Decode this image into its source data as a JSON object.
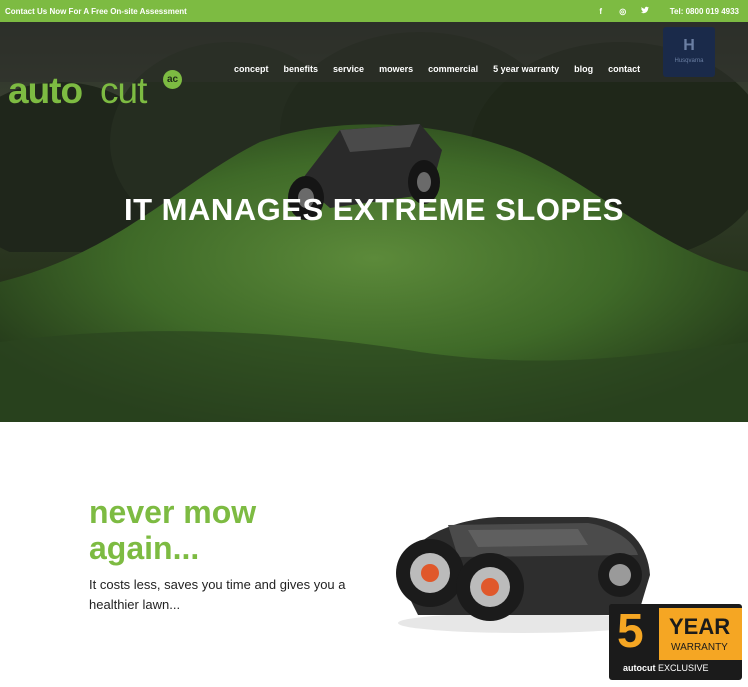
{
  "topbar": {
    "cta": "Contact Us Now For A Free On-site Assessment",
    "social": [
      {
        "icon": "facebook-icon",
        "glyph": "f"
      },
      {
        "icon": "instagram-icon",
        "glyph": "◎"
      },
      {
        "icon": "twitter-icon",
        "glyph": "🐦"
      }
    ],
    "phone": "Tel: 0800 019 4933"
  },
  "logo": {
    "auto": "auto",
    "cut": "cut",
    "badge": "ac"
  },
  "nav": [
    "concept",
    "benefits",
    "service",
    "mowers",
    "commercial",
    "5 year warranty",
    "blog",
    "contact"
  ],
  "brand": {
    "mark": "H",
    "name": "Husqvarna"
  },
  "hero": {
    "headline": "IT MANAGES EXTREME SLOPES"
  },
  "intro": {
    "title_line1": "never mow",
    "title_line2": "again...",
    "description": "It costs less, saves you time and gives you a healthier lawn..."
  },
  "warranty": {
    "number": "5",
    "year": "YEAR",
    "label": "WARRANTY",
    "brand": "autocut",
    "exclusive": "EXCLUSIVE"
  },
  "colors": {
    "accent": "#7dbb42",
    "warranty_orange": "#f5a623",
    "dark": "#1b1b1b"
  }
}
